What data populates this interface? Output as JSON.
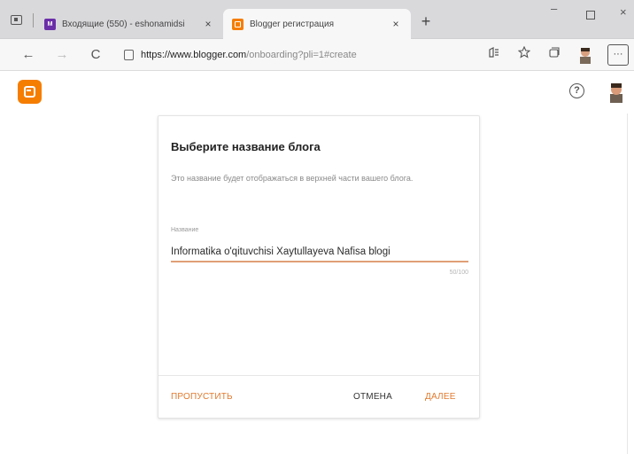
{
  "browser": {
    "tabs": [
      {
        "title": "Входящие (550) - eshonamidsi",
        "close": "×",
        "favicon": "mail-icon",
        "active": false
      },
      {
        "title": "Blogger регистрация",
        "close": "×",
        "favicon": "blogger-icon",
        "active": true
      }
    ],
    "new_tab": "+",
    "window_controls": {
      "minimize": "–",
      "maximize": "□",
      "close": "×"
    },
    "nav": {
      "back": "←",
      "forward": "→",
      "reload": "C"
    },
    "url": {
      "host": "https://www.blogger.com",
      "path": "/onboarding?pli=1#create"
    },
    "toolbar_icons": [
      "read-aloud-icon",
      "favorites-icon",
      "collections-icon",
      "profile-icon"
    ],
    "more": "···"
  },
  "appbar": {
    "logo": "blogger-logo",
    "help": "?",
    "avatar": "user-avatar"
  },
  "dialog": {
    "title": "Выберите название блога",
    "description": "Это название будет отображаться в верхней части вашего блога.",
    "field_label": "Название",
    "field_value": "Informatika o'qituvchisi Xaytullayeva Nafisa blogi",
    "char_count": "50/100",
    "buttons": {
      "skip": "ПРОПУСТИТЬ",
      "cancel": "ОТМЕНА",
      "next": "ДАЛЕЕ"
    }
  },
  "colors": {
    "accent": "#e07a2e",
    "blogger_orange": "#f57d00",
    "underline": "#e0a077"
  }
}
